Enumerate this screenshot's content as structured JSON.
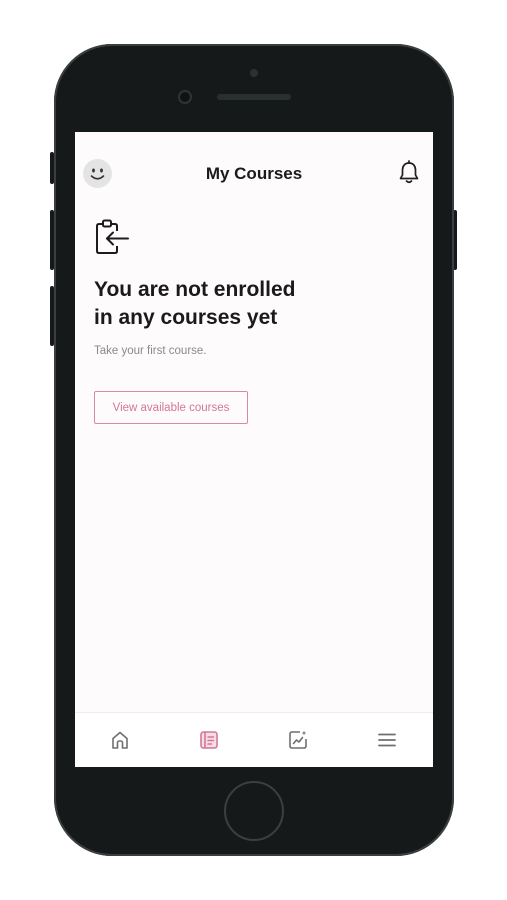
{
  "header": {
    "title": "My Courses",
    "avatar_icon": "smiley-avatar-icon",
    "notification_icon": "bell-icon"
  },
  "empty_state": {
    "icon": "clipboard-enter-icon",
    "heading_line1": "You are not enrolled",
    "heading_line2": "in any courses yet",
    "subtext": "Take your first course.",
    "cta_label": "View available courses"
  },
  "bottom_nav": {
    "items": [
      {
        "icon": "home-icon",
        "active": false
      },
      {
        "icon": "courses-icon",
        "active": true
      },
      {
        "icon": "progress-chart-icon",
        "active": false
      },
      {
        "icon": "menu-icon",
        "active": false
      }
    ]
  },
  "colors": {
    "accent": "#d47796",
    "text_primary": "#1a1a1a",
    "text_secondary": "#8a8a8a",
    "nav_inactive": "#6f6f6f",
    "device_frame": "#16191a",
    "screen_bg": "#fdfbfc"
  }
}
